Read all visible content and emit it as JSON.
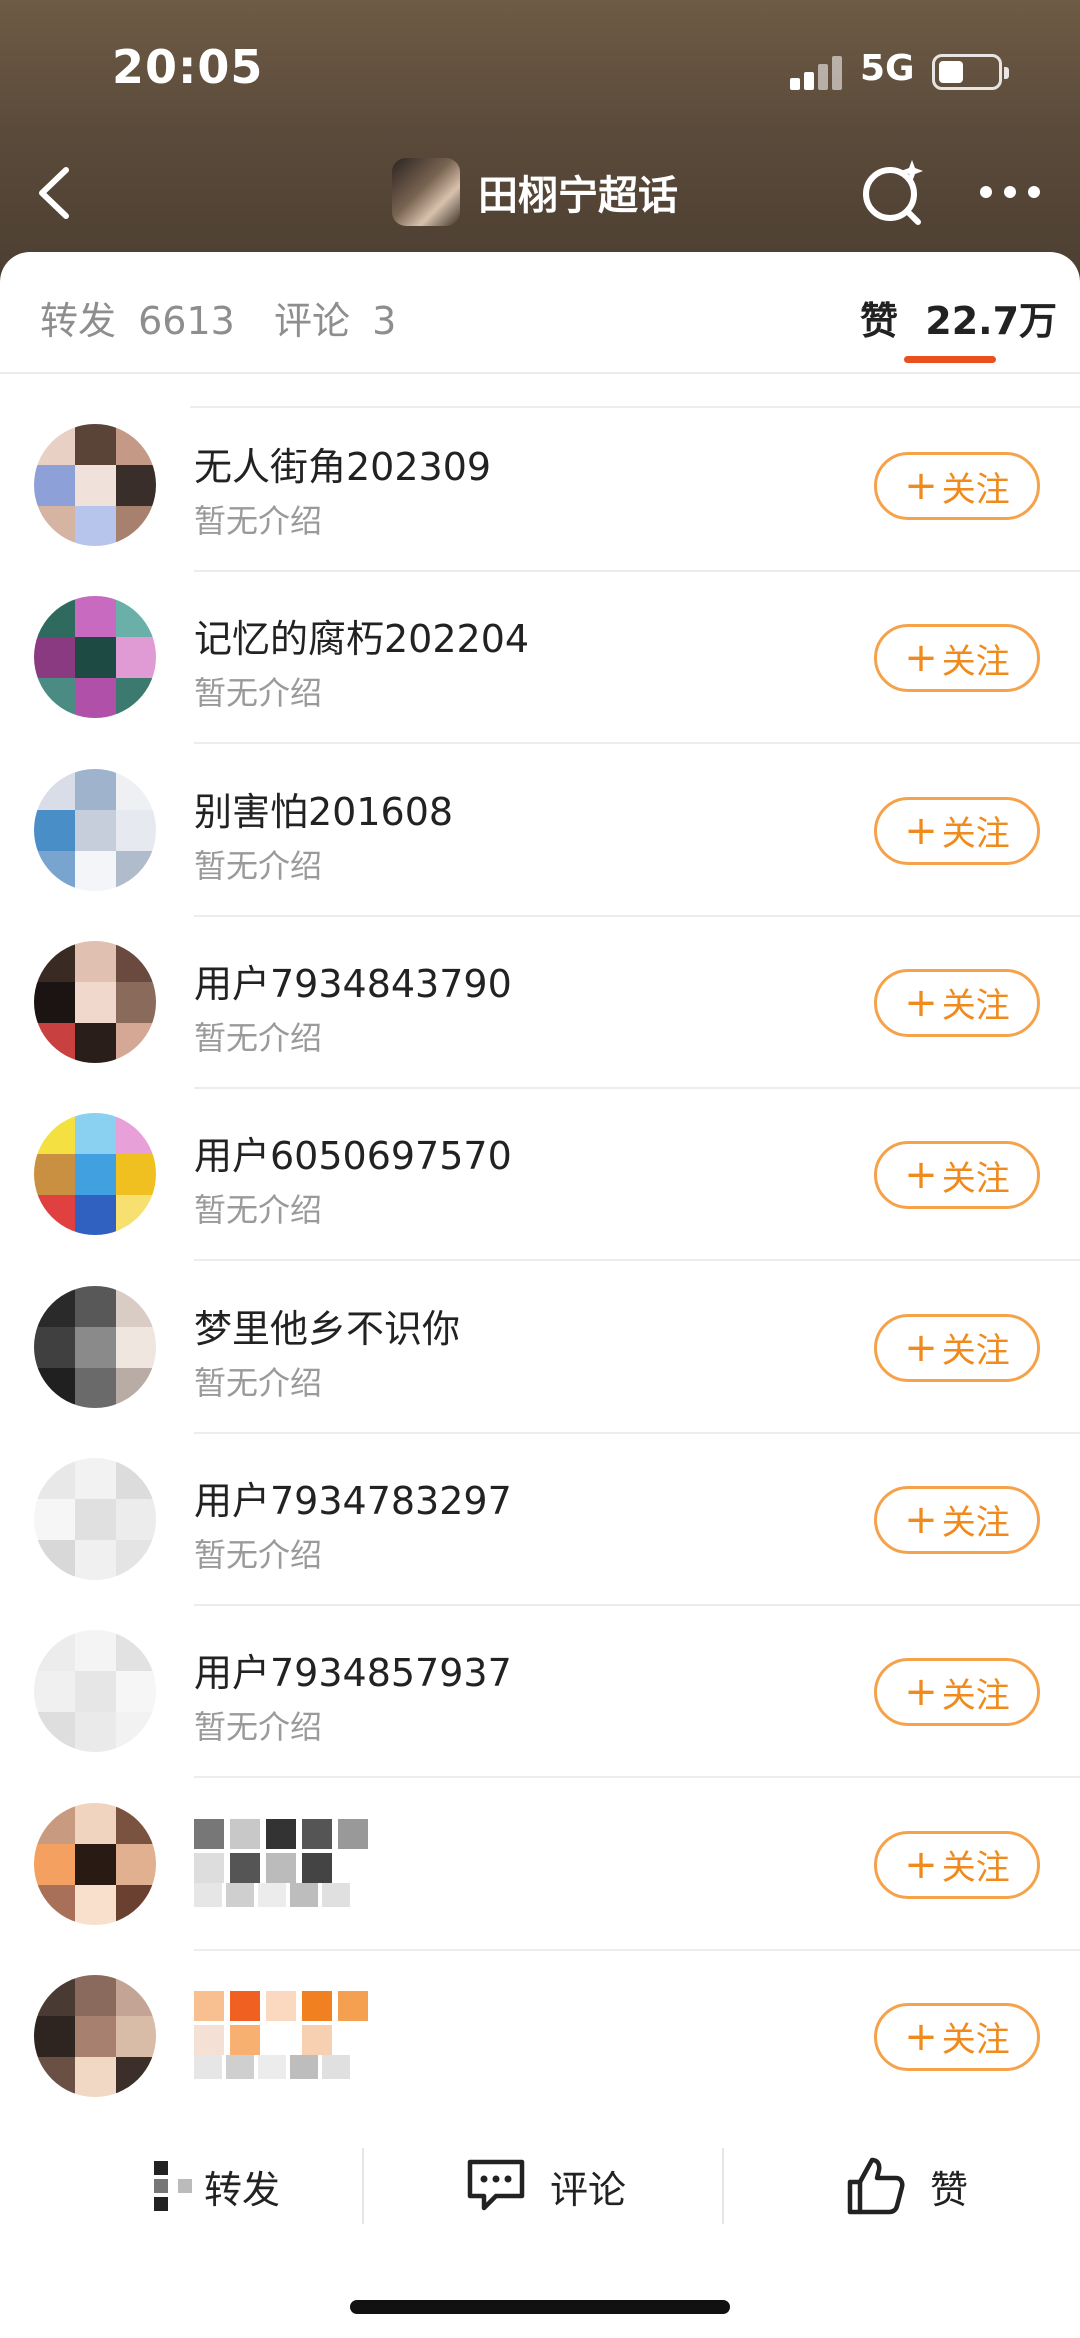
{
  "status_bar": {
    "time": "20:05",
    "network": "5G"
  },
  "nav": {
    "title": "田栩宁超话"
  },
  "tabs": [
    {
      "label": "转发",
      "count": "6613"
    },
    {
      "label": "评论",
      "count": "3"
    },
    {
      "label": "赞",
      "count": "22.7万"
    }
  ],
  "users": [
    {
      "name": "无人街角202309",
      "intro": "暂无介绍",
      "follow": "关注"
    },
    {
      "name": "记忆的腐朽202204",
      "intro": "暂无介绍",
      "follow": "关注"
    },
    {
      "name": "别害怕201608",
      "intro": "暂无介绍",
      "follow": "关注"
    },
    {
      "name": "用户7934843790",
      "intro": "暂无介绍",
      "follow": "关注"
    },
    {
      "name": "用户6050697570",
      "intro": "暂无介绍",
      "follow": "关注"
    },
    {
      "name": "梦里他乡不识你",
      "intro": "暂无介绍",
      "follow": "关注"
    },
    {
      "name": "用户7934783297",
      "intro": "暂无介绍",
      "follow": "关注"
    },
    {
      "name": "用户7934857937",
      "intro": "暂无介绍",
      "follow": "关注"
    },
    {
      "name": "",
      "intro": "",
      "follow": "关注"
    },
    {
      "name": "",
      "intro": "",
      "follow": "关注"
    }
  ],
  "bottom_bar": {
    "repost": "转发",
    "comment": "评论",
    "like": "赞"
  },
  "colors": {
    "accent": "#e8501e",
    "follow": "#f08a1c",
    "header": "#5a4a3a"
  }
}
